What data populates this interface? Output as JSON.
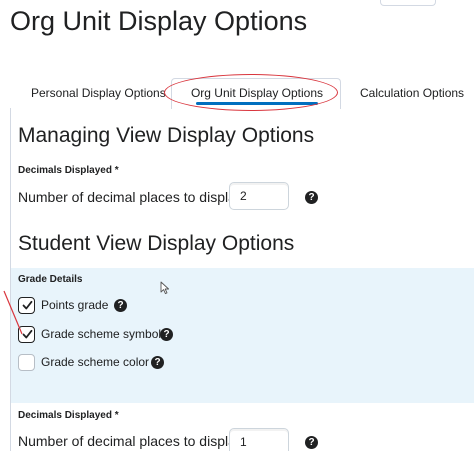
{
  "page": {
    "title": "Org Unit Display Options"
  },
  "tabs": [
    {
      "label": "Personal Display Options",
      "active": false
    },
    {
      "label": "Org Unit Display Options",
      "active": true
    },
    {
      "label": "Calculation Options",
      "active": false
    }
  ],
  "managing": {
    "heading": "Managing View Display Options",
    "decimals_label": "Decimals Displayed *",
    "decimals_text": "Number of decimal places to display",
    "decimals_value": "2"
  },
  "student": {
    "heading": "Student View Display Options",
    "grade_details_label": "Grade Details",
    "options": [
      {
        "label": "Points grade",
        "checked": true
      },
      {
        "label": "Grade scheme symbol",
        "checked": true
      },
      {
        "label": "Grade scheme color",
        "checked": false
      }
    ],
    "decimals_label": "Decimals Displayed *",
    "decimals_text": "Number of decimal places to display",
    "decimals_value": "1"
  },
  "help_glyph": "?",
  "colors": {
    "accent": "#006fbf",
    "annotation": "#d9363e",
    "shaded_bg": "#e8f4fb"
  }
}
